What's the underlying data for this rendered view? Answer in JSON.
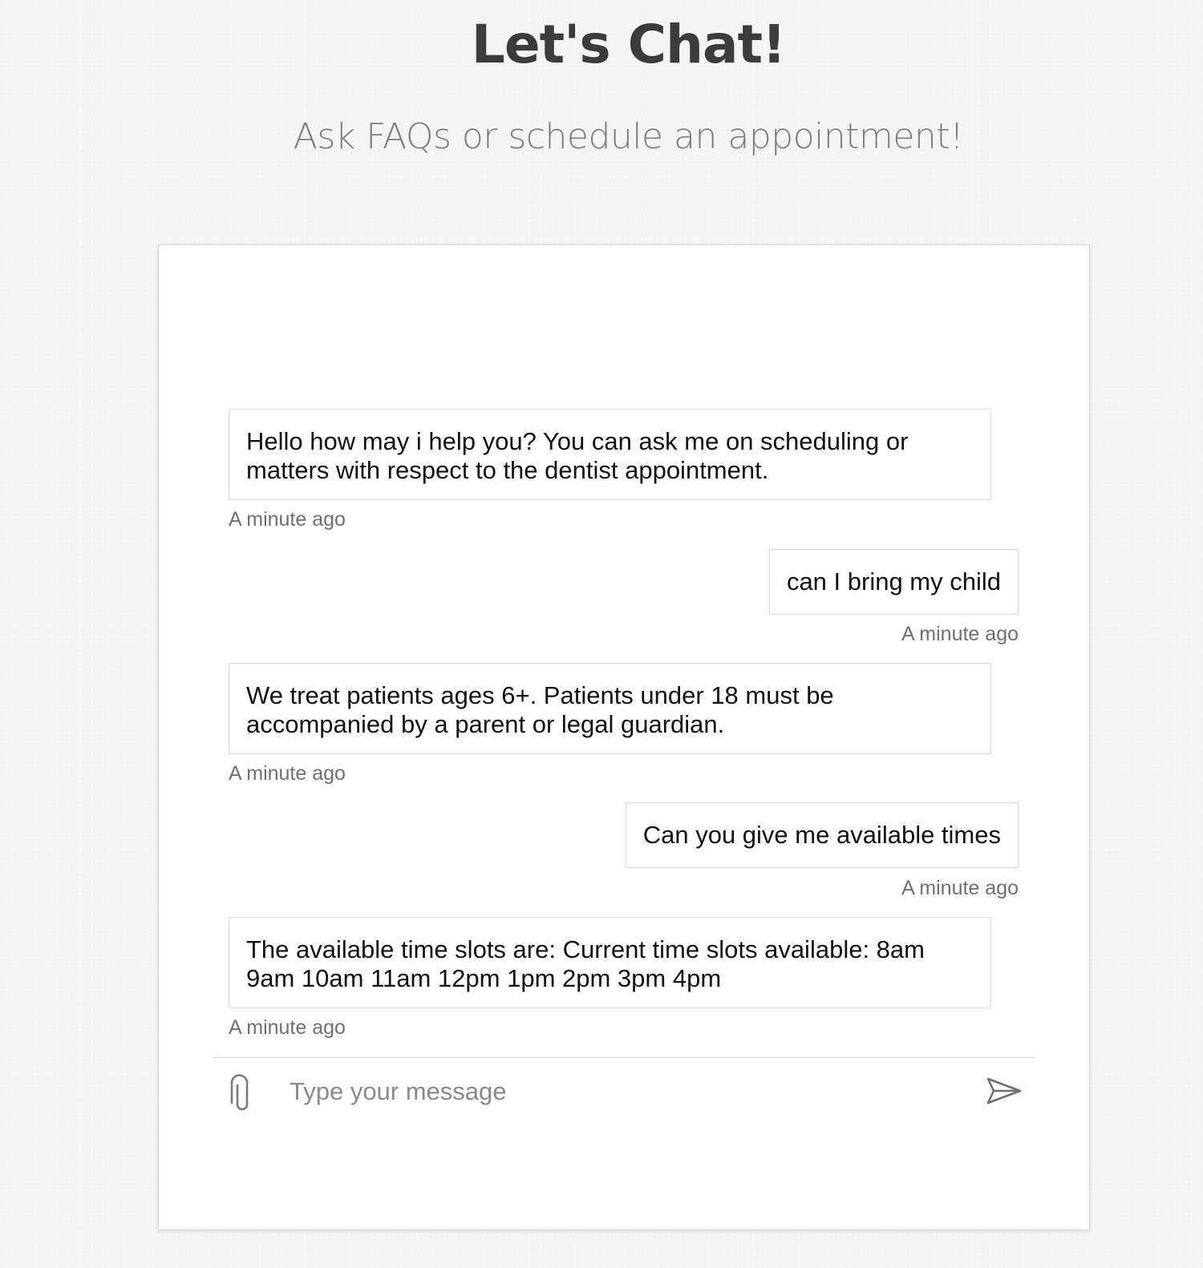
{
  "header": {
    "title": "Let's Chat!",
    "subtitle": "Ask FAQs or schedule an appointment!"
  },
  "chat": {
    "messages": [
      {
        "sender": "bot",
        "text": "Hello how may i help you? You can ask me on scheduling or matters with respect to the dentist appointment.",
        "timestamp": "A minute ago"
      },
      {
        "sender": "user",
        "text": "can I bring my child",
        "timestamp": "A minute ago"
      },
      {
        "sender": "bot",
        "text": "We treat patients ages 6+. Patients under 18 must be accompanied by a parent or legal guardian.",
        "timestamp": "A minute ago"
      },
      {
        "sender": "user",
        "text": "Can you give me available times",
        "timestamp": "A minute ago"
      },
      {
        "sender": "bot",
        "text": "The available time slots are: Current time slots available: 8am 9am 10am 11am 12pm 1pm 2pm 3pm 4pm",
        "timestamp": "A minute ago"
      }
    ]
  },
  "composer": {
    "placeholder": "Type your message",
    "value": "",
    "attach_icon": "paperclip-icon",
    "send_icon": "send-icon"
  },
  "colors": {
    "title": "#3c3c3c",
    "subtitle": "#7d7d7d",
    "page_background": "#f4f4f4",
    "bubble_border": "#d8d8d8",
    "timestamp": "#707070"
  }
}
